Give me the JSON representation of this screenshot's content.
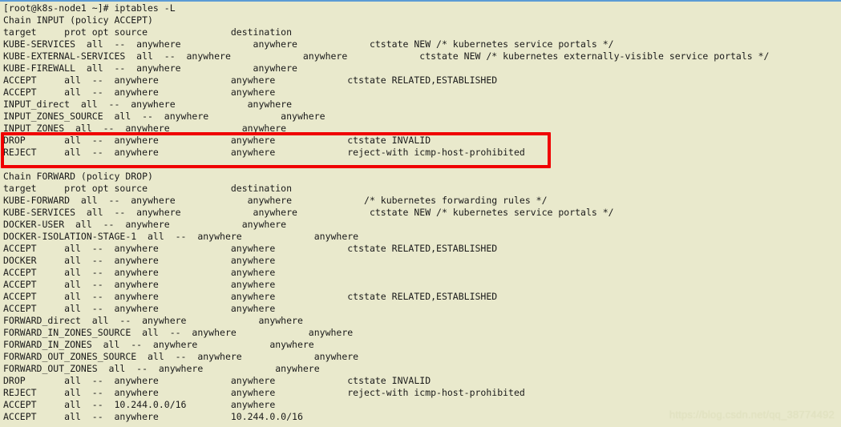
{
  "terminal": {
    "background_color": "#e9e9cc",
    "foreground_color": "#1a1a1a",
    "top_rule_color": "#5b9bd5",
    "prompt": "[root@k8s-node1 ~]#",
    "command": "iptables -L",
    "lines": [
      "[root@k8s-node1 ~]# iptables -L",
      "Chain INPUT (policy ACCEPT)",
      "target     prot opt source               destination",
      "KUBE-SERVICES  all  --  anywhere             anywhere             ctstate NEW /* kubernetes service portals */",
      "KUBE-EXTERNAL-SERVICES  all  --  anywhere             anywhere             ctstate NEW /* kubernetes externally-visible service portals */",
      "KUBE-FIREWALL  all  --  anywhere             anywhere",
      "ACCEPT     all  --  anywhere             anywhere             ctstate RELATED,ESTABLISHED",
      "ACCEPT     all  --  anywhere             anywhere",
      "INPUT_direct  all  --  anywhere             anywhere",
      "INPUT_ZONES_SOURCE  all  --  anywhere             anywhere",
      "INPUT_ZONES  all  --  anywhere             anywhere",
      "DROP       all  --  anywhere             anywhere             ctstate INVALID",
      "REJECT     all  --  anywhere             anywhere             reject-with icmp-host-prohibited",
      "",
      "Chain FORWARD (policy DROP)",
      "target     prot opt source               destination",
      "KUBE-FORWARD  all  --  anywhere             anywhere             /* kubernetes forwarding rules */",
      "KUBE-SERVICES  all  --  anywhere             anywhere             ctstate NEW /* kubernetes service portals */",
      "DOCKER-USER  all  --  anywhere             anywhere",
      "DOCKER-ISOLATION-STAGE-1  all  --  anywhere             anywhere",
      "ACCEPT     all  --  anywhere             anywhere             ctstate RELATED,ESTABLISHED",
      "DOCKER     all  --  anywhere             anywhere",
      "ACCEPT     all  --  anywhere             anywhere",
      "ACCEPT     all  --  anywhere             anywhere",
      "ACCEPT     all  --  anywhere             anywhere             ctstate RELATED,ESTABLISHED",
      "ACCEPT     all  --  anywhere             anywhere",
      "FORWARD_direct  all  --  anywhere             anywhere",
      "FORWARD_IN_ZONES_SOURCE  all  --  anywhere             anywhere",
      "FORWARD_IN_ZONES  all  --  anywhere             anywhere",
      "FORWARD_OUT_ZONES_SOURCE  all  --  anywhere             anywhere",
      "FORWARD_OUT_ZONES  all  --  anywhere             anywhere",
      "DROP       all  --  anywhere             anywhere             ctstate INVALID",
      "REJECT     all  --  anywhere             anywhere             reject-with icmp-host-prohibited",
      "ACCEPT     all  --  10.244.0.0/16        anywhere",
      "ACCEPT     all  --  anywhere             10.244.0.0/16"
    ]
  },
  "annotation": {
    "highlight_box": {
      "color": "#f00000",
      "covers_lines": [
        "DROP       all  --  anywhere             anywhere             ctstate INVALID",
        "REJECT     all  --  anywhere             anywhere             reject-with icmp-host-prohibited"
      ]
    }
  },
  "watermark": {
    "text": "https://blog.csdn.net/qq_38774492",
    "color": "#e2e3c2"
  }
}
